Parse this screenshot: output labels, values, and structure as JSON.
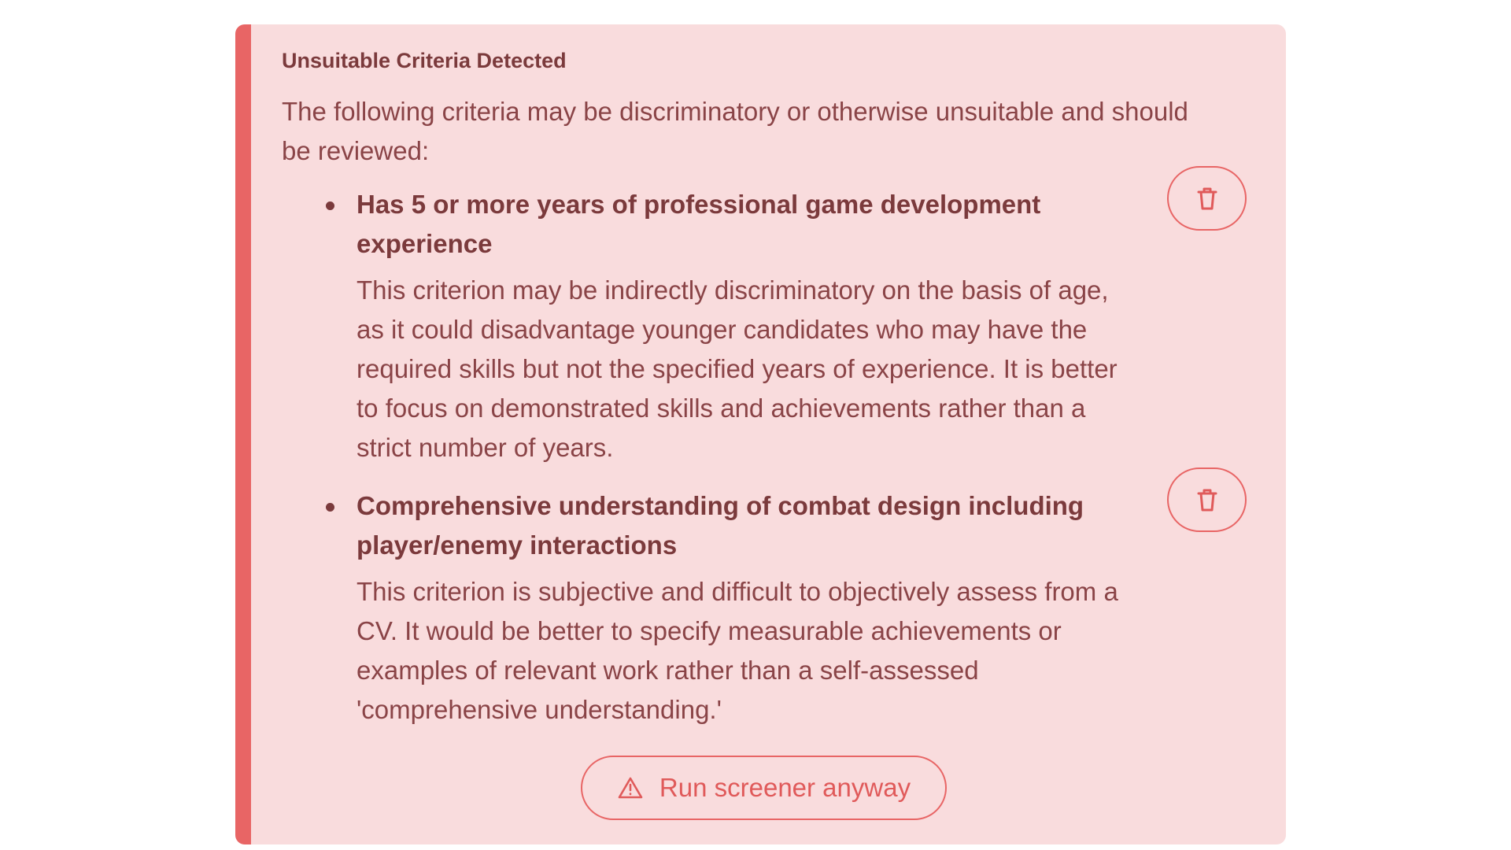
{
  "alert": {
    "title": "Unsuitable Criteria Detected",
    "intro": "The following criteria may be discriminatory or otherwise unsuitable and should be reviewed:",
    "accent_color": "#e86565",
    "background_color": "#f9dcdd"
  },
  "criteria": [
    {
      "title": "Has 5 or more years of professional game development experience",
      "description": "This criterion may be indirectly discriminatory on the basis of age, as it could disadvantage younger candidates who may have the required skills but not the specified years of experience. It is better to focus on demonstrated skills and achievements rather than a strict number of years.",
      "action_icon": "trash-icon"
    },
    {
      "title": "Comprehensive understanding of combat design including player/enemy interactions",
      "description": "This criterion is subjective and difficult to objectively assess from a CV. It would be better to specify measurable achievements or examples of relevant work rather than a self-assessed 'comprehensive understanding.'",
      "action_icon": "trash-icon"
    }
  ],
  "actions": {
    "run_anyway_label": "Run screener anyway",
    "run_anyway_icon": "warning-triangle-icon"
  }
}
